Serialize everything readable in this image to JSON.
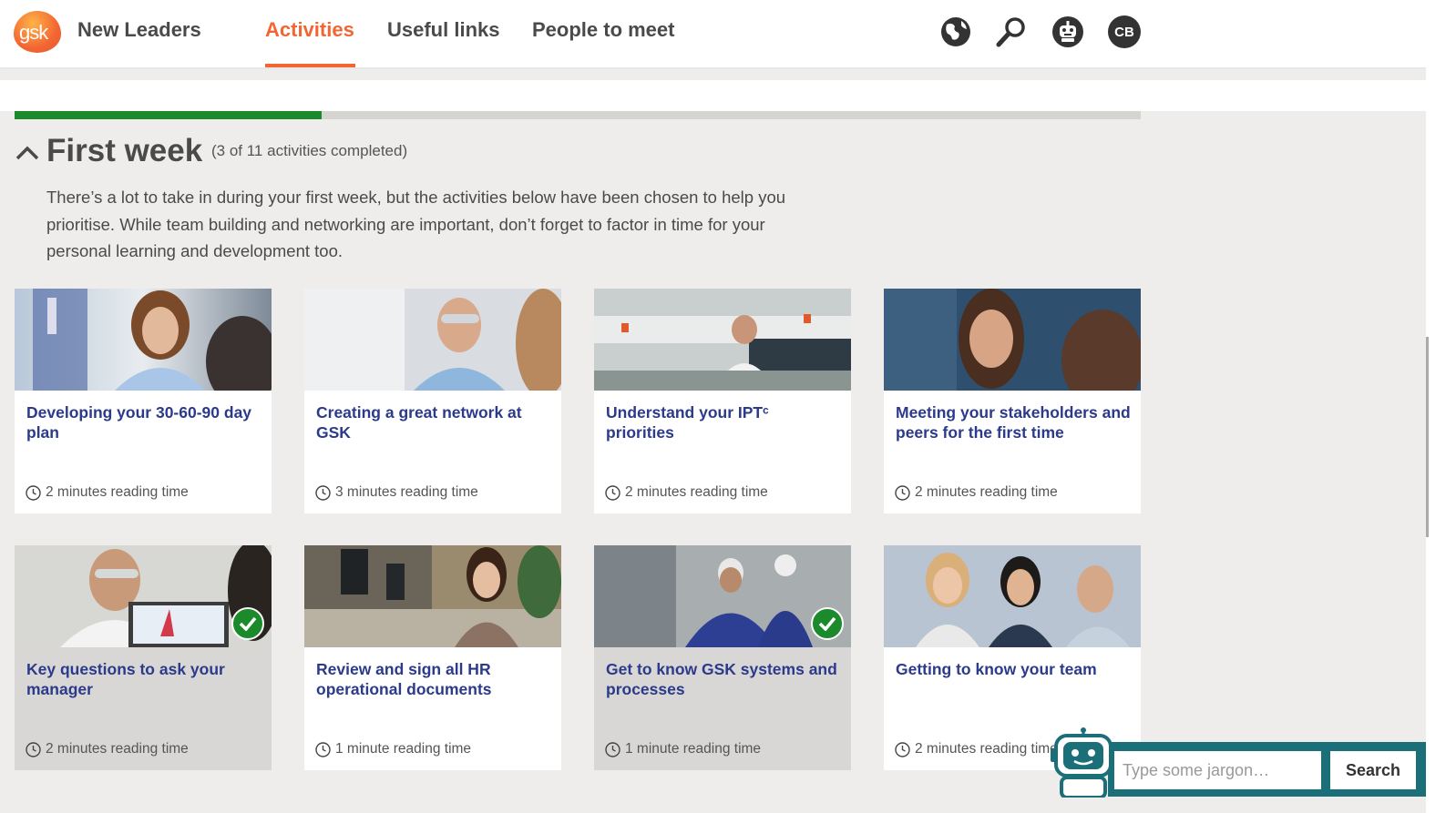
{
  "header": {
    "logo_text": "gsk",
    "app_title": "New Leaders",
    "nav": [
      {
        "label": "Activities",
        "active": true
      },
      {
        "label": "Useful links",
        "active": false
      },
      {
        "label": "People to meet",
        "active": false
      }
    ],
    "icons": [
      "globe-icon",
      "search-icon",
      "robot-icon"
    ],
    "avatar_initials": "CB"
  },
  "section": {
    "title": "First week",
    "count": "(3 of 11 activities completed)",
    "progress_fraction": 0.2727,
    "intro": "There’s a lot to take in during your first week, but the activities below have been chosen to help you prioritise. While team building and networking are important, don’t forget to factor in time for your personal learning and development too."
  },
  "cards": [
    {
      "title": "Developing your 30-60-90 day plan",
      "time": "2 minutes reading time",
      "completed": false
    },
    {
      "title": "Creating a great network at GSK",
      "time": "3 minutes reading time",
      "completed": false
    },
    {
      "title": "Understand your IPTᶜ priorities",
      "time": "2 minutes reading time",
      "completed": false
    },
    {
      "title": "Meeting your stakeholders and peers for the first time",
      "time": "2 minutes reading time",
      "completed": false
    },
    {
      "title": "Key questions to ask your manager",
      "time": "2 minutes reading time",
      "completed": true
    },
    {
      "title": "Review and sign all HR operational documents",
      "time": "1 minute reading time",
      "completed": false
    },
    {
      "title": "Get to know GSK systems and processes",
      "time": "1 minute reading time",
      "completed": true
    },
    {
      "title": "Getting to know your team",
      "time": "2 minutes reading time",
      "completed": false
    }
  ],
  "jargon": {
    "placeholder": "Type some jargon…",
    "button_label": "Search"
  },
  "colors": {
    "accent": "#f36633",
    "progress": "#1b8a2a",
    "card_title": "#2b3a8a",
    "jargon_bar": "#1a6f79"
  }
}
